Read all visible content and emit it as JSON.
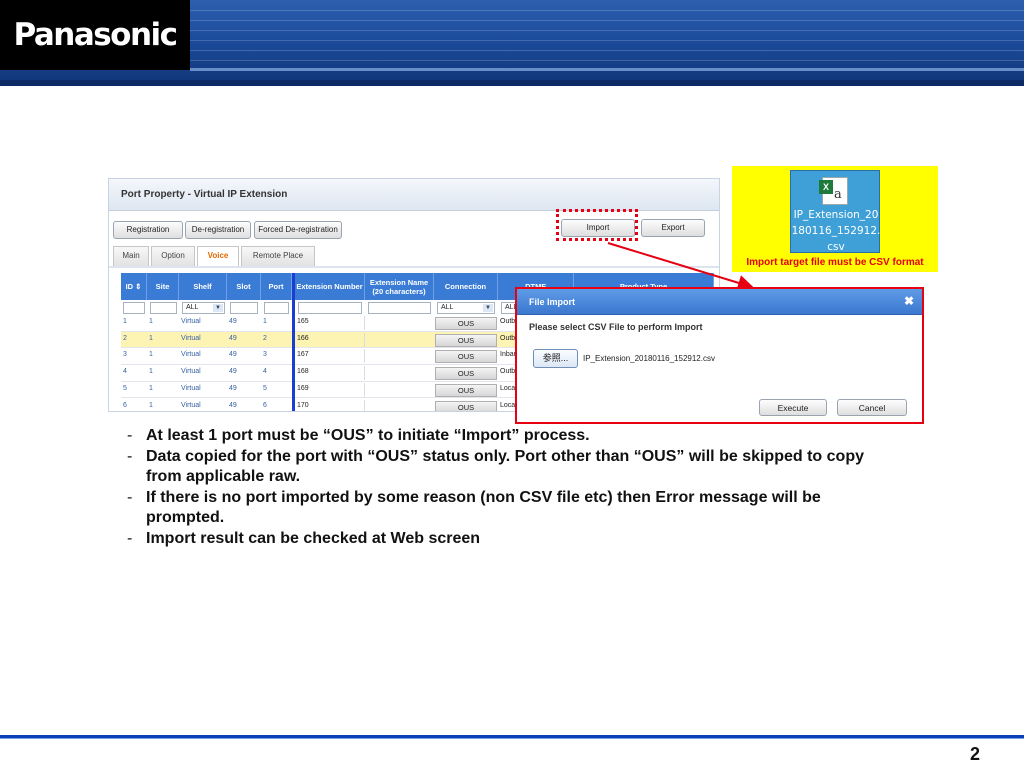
{
  "brand": {
    "logo": "Panasonic"
  },
  "app": {
    "title": "Port Property - Virtual IP Extension",
    "toolbar": {
      "registration": "Registration",
      "deregistration": "De-registration",
      "forced_deregistration": "Forced De-registration",
      "import": "Import",
      "export": "Export"
    },
    "tabs": [
      {
        "label": "Main",
        "active": false
      },
      {
        "label": "Option",
        "active": false
      },
      {
        "label": "Voice",
        "active": true
      },
      {
        "label": "Remote Place",
        "active": false
      }
    ],
    "table": {
      "headers": [
        "ID ⇕",
        "Site",
        "Shelf",
        "Slot",
        "Port",
        "Extension Number",
        "Extension Name (20 characters)",
        "Connection",
        "DTMF",
        "Product Type"
      ],
      "filter_all": "ALL",
      "rows": [
        {
          "id": "1",
          "site": "1",
          "shelf": "Virtual",
          "slot": "49",
          "port": "1",
          "ext": "165",
          "conn": "OUS",
          "type": "Outb",
          "highlight": false
        },
        {
          "id": "2",
          "site": "1",
          "shelf": "Virtual",
          "slot": "49",
          "port": "2",
          "ext": "166",
          "conn": "OUS",
          "type": "Outb",
          "highlight": true
        },
        {
          "id": "3",
          "site": "1",
          "shelf": "Virtual",
          "slot": "49",
          "port": "3",
          "ext": "167",
          "conn": "OUS",
          "type": "Inbar",
          "highlight": false
        },
        {
          "id": "4",
          "site": "1",
          "shelf": "Virtual",
          "slot": "49",
          "port": "4",
          "ext": "168",
          "conn": "OUS",
          "type": "Outb",
          "highlight": false
        },
        {
          "id": "5",
          "site": "1",
          "shelf": "Virtual",
          "slot": "49",
          "port": "5",
          "ext": "169",
          "conn": "OUS",
          "type": "Loca",
          "highlight": false
        },
        {
          "id": "6",
          "site": "1",
          "shelf": "Virtual",
          "slot": "49",
          "port": "6",
          "ext": "170",
          "conn": "OUS",
          "type": "Loca",
          "highlight": false
        }
      ]
    }
  },
  "csv_callout": {
    "file_line1": "IP_Extension_20",
    "file_line2": "180116_152912.",
    "file_line3": "csv",
    "caption": "Import target file must be CSV format"
  },
  "dialog": {
    "title": "File Import",
    "close": "✖",
    "prompt": "Please select CSV File to perform Import",
    "browse": "参照...",
    "file": "IP_Extension_20180116_152912.csv",
    "execute": "Execute",
    "cancel": "Cancel"
  },
  "notes": [
    "At least 1 port must be “OUS” to initiate “Import” process.",
    "Data copied for the port with “OUS” status only. Port other than “OUS” will be skipped to copy from applicable raw.",
    "If there is no port imported by some reason (non CSV file etc) then Error message will be prompted.",
    "Import result can be checked at Web screen"
  ],
  "note_dash": "-",
  "page_number": "2",
  "colors": {
    "accent_red": "#e60012",
    "header_blue": "#3a7bd5",
    "banner": "#1d4c9c",
    "callout_yellow": "#ffff00"
  }
}
